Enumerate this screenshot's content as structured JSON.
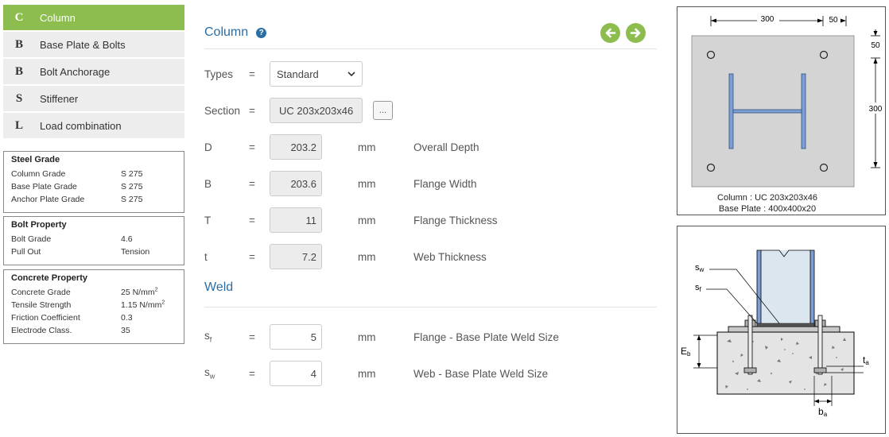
{
  "nav": [
    {
      "letter": "C",
      "label": "Column",
      "active": true
    },
    {
      "letter": "B",
      "label": "Base Plate & Bolts",
      "active": false
    },
    {
      "letter": "B",
      "label": "Bolt Anchorage",
      "active": false
    },
    {
      "letter": "S",
      "label": "Stiffener",
      "active": false
    },
    {
      "letter": "L",
      "label": "Load combination",
      "active": false
    }
  ],
  "steel_grade": {
    "title": "Steel Grade",
    "rows": [
      {
        "key": "Column Grade",
        "val": "S 275"
      },
      {
        "key": "Base Plate Grade",
        "val": "S 275"
      },
      {
        "key": "Anchor Plate Grade",
        "val": "S 275"
      }
    ]
  },
  "bolt_property": {
    "title": "Bolt Property",
    "rows": [
      {
        "key": "Bolt Grade",
        "val": "4.6"
      },
      {
        "key": "Pull Out",
        "val": "Tension"
      }
    ]
  },
  "concrete_property": {
    "title": "Concrete Property",
    "rows": [
      {
        "key": "Concrete Grade",
        "val": "25 N/mm",
        "sup": "2"
      },
      {
        "key": "Tensile Strength",
        "val": "1.15 N/mm",
        "sup": "2"
      },
      {
        "key": "Friction Coefficient",
        "val": "0.3"
      },
      {
        "key": "Electrode Class.",
        "val": "35"
      }
    ]
  },
  "column_section": {
    "title": "Column",
    "help": "?",
    "types_label": "Types",
    "types_value": "Standard",
    "section_label": "Section",
    "section_value": "UC 203x203x46",
    "section_button": "...",
    "eq": "=",
    "dims": [
      {
        "label": "D",
        "value": "203.2",
        "unit": "mm",
        "desc": "Overall Depth"
      },
      {
        "label": "B",
        "value": "203.6",
        "unit": "mm",
        "desc": "Flange Width"
      },
      {
        "label": "T",
        "value": "11",
        "unit": "mm",
        "desc": "Flange Thickness"
      },
      {
        "label": "t",
        "value": "7.2",
        "unit": "mm",
        "desc": "Web Thickness"
      }
    ]
  },
  "weld_section": {
    "title": "Weld",
    "rows": [
      {
        "label": "s",
        "sub": "f",
        "value": "5",
        "unit": "mm",
        "desc": "Flange - Base Plate Weld Size"
      },
      {
        "label": "s",
        "sub": "w",
        "value": "4",
        "unit": "mm",
        "desc": "Web - Base Plate Weld Size"
      }
    ]
  },
  "plan_diagram": {
    "dim_top_1": "300",
    "dim_top_2": "50",
    "dim_right_1": "50",
    "dim_right_2": "300",
    "caption_1": "Column : UC 203x203x46",
    "caption_2": "Base Plate : 400x400x20"
  },
  "section_diagram": {
    "label_sw": "s",
    "label_sw_sub": "w",
    "label_sf": "s",
    "label_sf_sub": "f",
    "label_eb": "E",
    "label_eb_sub": "b",
    "label_ta": "t",
    "label_ta_sub": "a",
    "label_ba": "b",
    "label_ba_sub": "a"
  },
  "colors": {
    "accent_green": "#8cbd4e",
    "accent_blue": "#2a6ea6",
    "plate_gray": "#d4d4d4",
    "column_blue": "#7d9fd3"
  }
}
